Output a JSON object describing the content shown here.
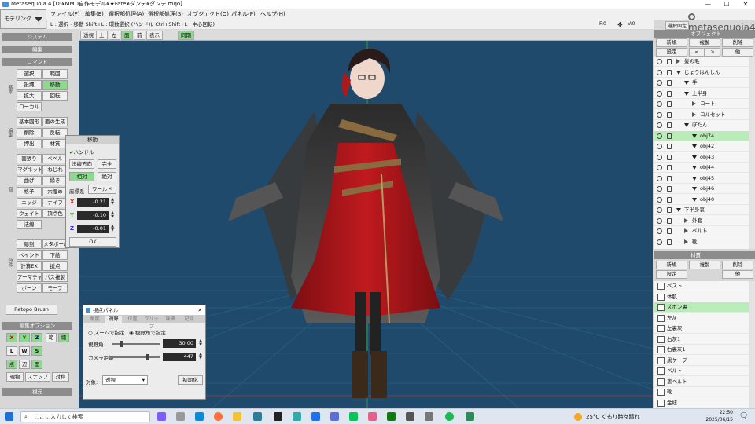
{
  "window": {
    "title": "Metasequoia 4 [D:¥MMD自作モデル¥★Fate¥ダンテ¥ダンテ.mqo]",
    "min": "—",
    "max": "☐",
    "close": "✕"
  },
  "mode": {
    "label": "モデリング"
  },
  "menu": [
    "ファイル(F)",
    "編集(E)",
    "選択部処理(A)",
    "選択部処理(S)",
    "オブジェクト(O)",
    "パネル(P)",
    "ヘルプ(H)"
  ],
  "hint": "L : 選択・移動  Shift+L : 環数選択 (ハンドル  Ctrl+Shift+L : 中心回転)",
  "statusbar": {
    "f": "F:0",
    "v": "V:0",
    "sel_fix": "選択固定"
  },
  "logo": {
    "name": "metasequoia4"
  },
  "viewtabs": [
    "透視",
    "上",
    "左",
    "面",
    "前",
    "表示",
    "同期"
  ],
  "viewtabs_on": [
    3,
    6
  ],
  "left": {
    "system": "システム",
    "edit": "編集",
    "command": "コマンド",
    "cmd_buttons": [
      [
        "選択",
        "範囲"
      ],
      [
        "投縄",
        "移動"
      ],
      [
        "拡大",
        "回転"
      ],
      [
        "ローカル",
        ""
      ],
      [
        "基本図形",
        "面の生成"
      ],
      [
        "削除",
        "反転"
      ],
      [
        "押出",
        "材質"
      ],
      [
        "面張り",
        "ベベル"
      ],
      [
        "マグネット",
        "ねじれ"
      ],
      [
        "曲げ",
        "縁き"
      ],
      [
        "格子",
        "穴埋め"
      ],
      [
        "エッジ",
        "ナイフ"
      ],
      [
        "ウェイト",
        "頂点色"
      ],
      [
        "法線",
        ""
      ],
      [
        "彫刻",
        "メタボール"
      ],
      [
        "ペイント",
        "下絵"
      ],
      [
        "計算EX",
        "援点"
      ],
      [
        "アーマチャー",
        "パス複製"
      ],
      [
        "ボーン",
        "モーフ"
      ]
    ],
    "side_labels": [
      "基本",
      "編集",
      "面",
      "特殊"
    ],
    "retopo": "Retopo Brush",
    "edit_option": "編集オプション",
    "axis_buttons": [
      "X",
      "Y",
      "Z",
      "範",
      "縄"
    ],
    "lws_buttons": [
      "L",
      "W",
      "S"
    ],
    "point_buttons": [
      "点",
      "辺",
      "面"
    ],
    "snap_buttons": [
      "現物",
      "スナップ",
      "対称"
    ],
    "view": "視元"
  },
  "move_dialog": {
    "title": "移動",
    "handle": "ハンドル",
    "normal_dir": "法線方向",
    "fixed": "完全",
    "relative": "相対",
    "absolute": "絶対",
    "coord": "座標系",
    "world": "ワールド",
    "x_label": "X",
    "y_label": "Y",
    "z_label": "Z",
    "x": "-0.21",
    "y": "-0.10",
    "z": "-0.01",
    "ok": "OK"
  },
  "view_panel": {
    "title": "視点パネル",
    "close": "✕",
    "tabs": [
      "角度",
      "視野",
      "位置",
      "クリップ",
      "詳細",
      "記録"
    ],
    "active_tab": 1,
    "radio1": "ズームで指定",
    "radio2": "視野角で指定",
    "fov_label": "視野角",
    "fov": "30.00",
    "dist_label": "カメラ距離",
    "dist": "447",
    "fov_level": 0.18,
    "dist_level": 0.74,
    "target_label": "対象:",
    "target": "透視",
    "reset": "初期化"
  },
  "objects": {
    "header": "オブジェクト",
    "new": "新規",
    "copy": "複製",
    "del": "削除",
    "settings": "設定",
    "prev": "<",
    "next": ">",
    "merge": "他",
    "rows": [
      {
        "name": "髪の毛",
        "indent": 0,
        "tri": false,
        "sel": false
      },
      {
        "name": "じょうはんしん",
        "indent": 0,
        "tri": true,
        "sel": false
      },
      {
        "name": "手",
        "indent": 1,
        "tri": true,
        "sel": false
      },
      {
        "name": "上半身",
        "indent": 1,
        "tri": true,
        "sel": false
      },
      {
        "name": "コート",
        "indent": 2,
        "tri": false,
        "sel": false
      },
      {
        "name": "コルセット",
        "indent": 2,
        "tri": false,
        "sel": false
      },
      {
        "name": "ぼたん",
        "indent": 1,
        "tri": true,
        "sel": false
      },
      {
        "name": "obj74",
        "indent": 2,
        "tri": true,
        "sel": true
      },
      {
        "name": "obj42",
        "indent": 2,
        "tri": true,
        "sel": false
      },
      {
        "name": "obj43",
        "indent": 2,
        "tri": true,
        "sel": false
      },
      {
        "name": "obj44",
        "indent": 2,
        "tri": true,
        "sel": false
      },
      {
        "name": "obj45",
        "indent": 2,
        "tri": true,
        "sel": false
      },
      {
        "name": "obj46",
        "indent": 2,
        "tri": true,
        "sel": false
      },
      {
        "name": "obj40",
        "indent": 2,
        "tri": true,
        "sel": false
      },
      {
        "name": "下半身裏",
        "indent": 0,
        "tri": true,
        "sel": false
      },
      {
        "name": "外套",
        "indent": 1,
        "tri": false,
        "sel": false
      },
      {
        "name": "ベルト",
        "indent": 1,
        "tri": false,
        "sel": false
      },
      {
        "name": "靴",
        "indent": 1,
        "tri": false,
        "sel": false
      }
    ]
  },
  "materials": {
    "header": "材質",
    "new": "新規",
    "copy": "複製",
    "del": "削除",
    "settings": "設定",
    "merge": "他",
    "rows": [
      "ベスト",
      "体肌",
      "ズボン裏",
      "左灰",
      "左裏灰",
      "右灰1",
      "右裏灰1",
      "黒ケープ",
      "ベルト",
      "裏ベルト",
      "靴",
      "金紐"
    ],
    "selected": 2
  },
  "taskbar": {
    "search": "ここに入力して検索",
    "weather": "25°C  くもり時々晴れ",
    "time": "22:50",
    "date": "2025/06/15"
  }
}
